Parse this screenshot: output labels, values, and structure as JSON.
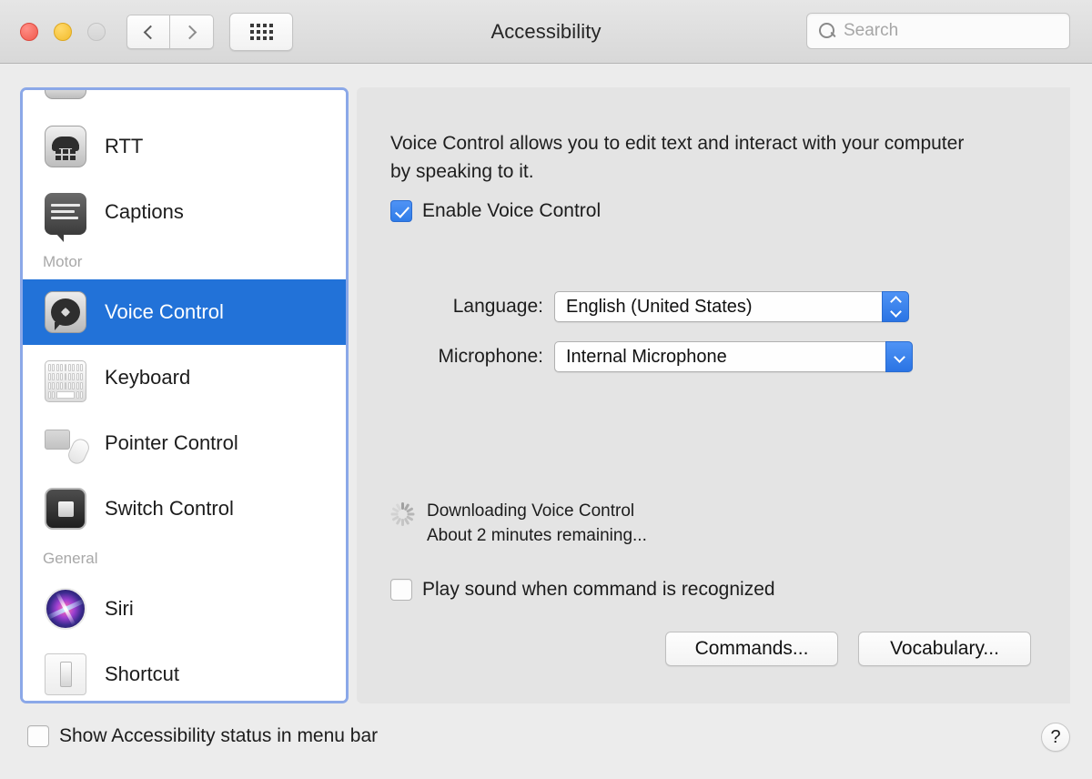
{
  "window": {
    "title": "Accessibility",
    "traffic_lights": [
      "close-button",
      "minimize-button",
      "zoom-button"
    ],
    "nav_back_label": "‹",
    "nav_forward_label": "›",
    "grid_button_label": "show-all",
    "colors": {
      "accent": "#2272d8",
      "checkbox_on": "#2f7ce8",
      "toolbar_bg": "#dcdcdc",
      "panel_bg": "#e4e4e4",
      "sidebar_bg": "#ffffff",
      "focus_ring": "#8ba8e8",
      "close_red": "#f1594d",
      "minimize_yellow": "#f3bc2d"
    }
  },
  "search": {
    "placeholder": "Search",
    "value": ""
  },
  "sidebar": {
    "items": [
      {
        "label": "RTT",
        "icon": "rtt-icon",
        "selected": false,
        "type": "item"
      },
      {
        "label": "Captions",
        "icon": "captions-icon",
        "selected": false,
        "type": "item"
      },
      {
        "label": "Motor",
        "type": "group"
      },
      {
        "label": "Voice Control",
        "icon": "voice-control-icon",
        "selected": true,
        "type": "item"
      },
      {
        "label": "Keyboard",
        "icon": "keyboard-icon",
        "selected": false,
        "type": "item"
      },
      {
        "label": "Pointer Control",
        "icon": "pointer-control-icon",
        "selected": false,
        "type": "item"
      },
      {
        "label": "Switch Control",
        "icon": "switch-control-icon",
        "selected": false,
        "type": "item"
      },
      {
        "label": "General",
        "type": "group"
      },
      {
        "label": "Siri",
        "icon": "siri-icon",
        "selected": false,
        "type": "item"
      },
      {
        "label": "Shortcut",
        "icon": "shortcut-icon",
        "selected": false,
        "type": "item"
      }
    ]
  },
  "main": {
    "description": "Voice Control allows you to edit text and interact with your computer by speaking to it.",
    "enable_checkbox": {
      "label": "Enable Voice Control",
      "checked": true
    },
    "language": {
      "label": "Language:",
      "value": "English (United States)"
    },
    "microphone": {
      "label": "Microphone:",
      "value": "Internal Microphone"
    },
    "download_status": {
      "line1": "Downloading Voice Control",
      "line2": "About 2 minutes remaining..."
    },
    "play_sound_checkbox": {
      "label": "Play sound when command is recognized",
      "checked": false
    },
    "commands_button": "Commands...",
    "vocabulary_button": "Vocabulary..."
  },
  "bottom": {
    "show_status_checkbox": {
      "label": "Show Accessibility status in menu bar",
      "checked": false
    },
    "help_button": "?"
  }
}
